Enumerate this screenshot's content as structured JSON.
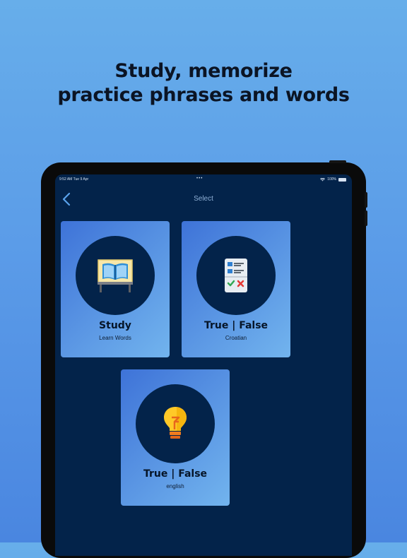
{
  "headline": {
    "line1": "Study, memorize",
    "line2": "practice phrases and words"
  },
  "status_bar": {
    "time": "9:52 AM  Tue 9 Apr",
    "dots": "•••",
    "battery": "100%"
  },
  "nav": {
    "title": "Select",
    "back_icon": "chevron-left-icon"
  },
  "cards": [
    {
      "title": "Study",
      "subtitle": "Learn Words",
      "icon": "book-stand-icon"
    },
    {
      "title": "True | False",
      "subtitle": "Croatian",
      "icon": "checklist-icon"
    },
    {
      "title": "True | False",
      "subtitle": "english",
      "icon": "lightbulb-icon"
    }
  ],
  "colors": {
    "page_background": "#5b9ce8",
    "screen_background": "#03234a",
    "accent": "#5b97e4"
  }
}
